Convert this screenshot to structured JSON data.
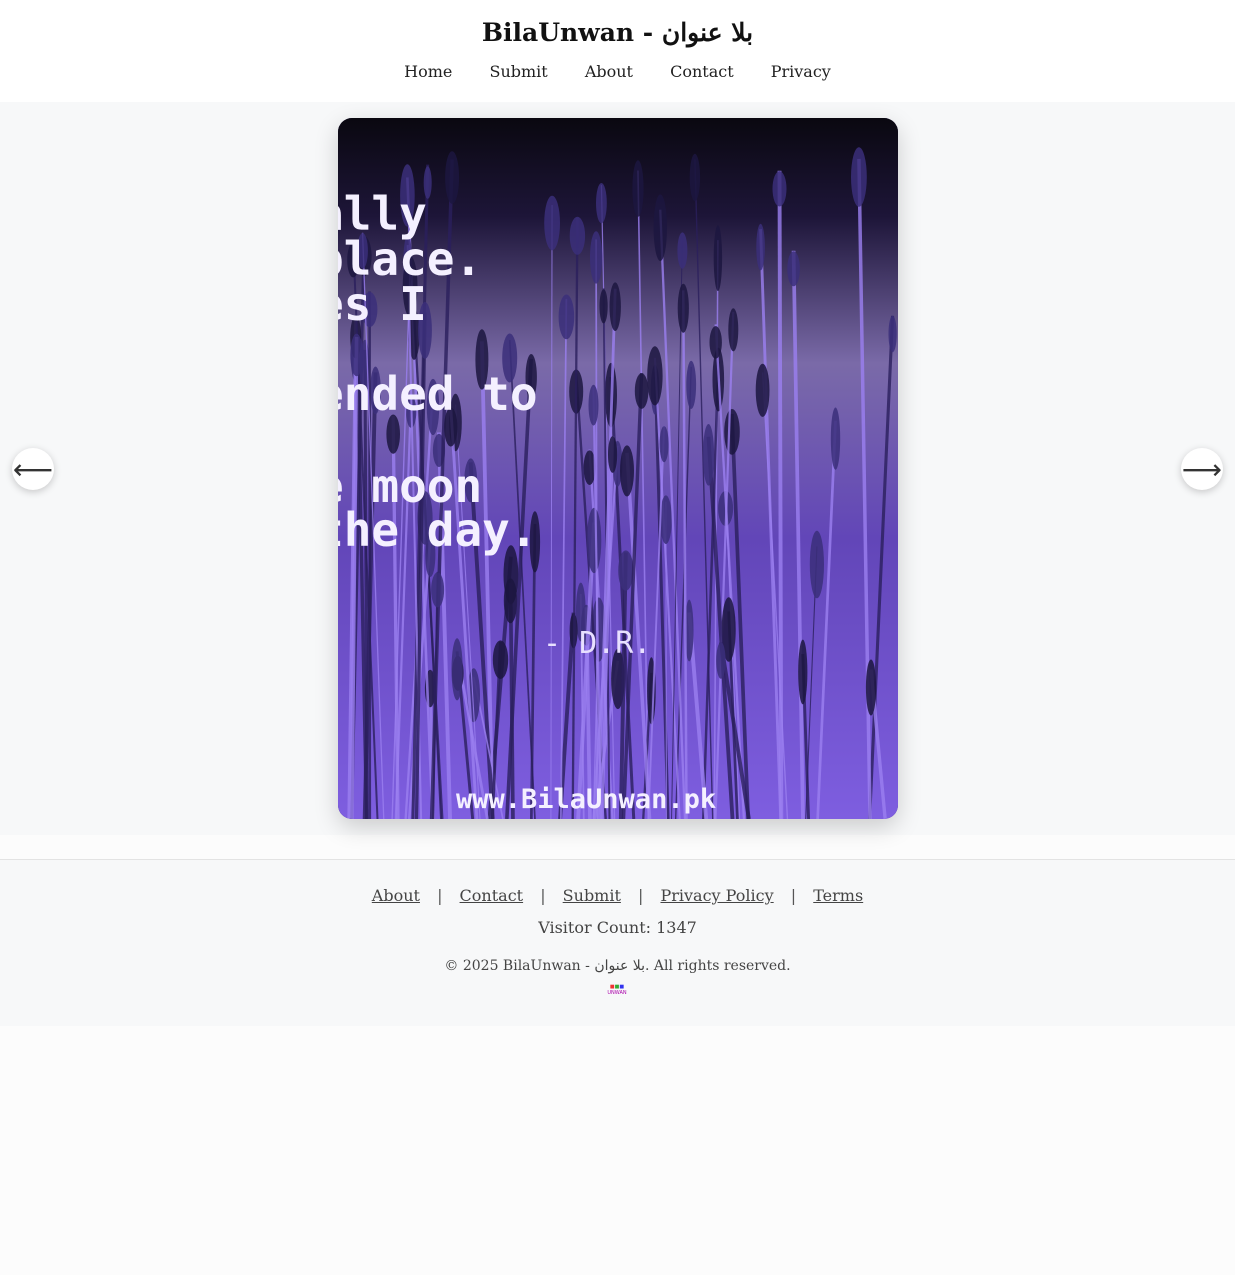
{
  "site": {
    "title": "BilaUnwan - بلا عنوان"
  },
  "nav": {
    "items": [
      "Home",
      "Submit",
      "About",
      "Contact",
      "Privacy"
    ]
  },
  "slider": {
    "prev_icon": "arrow-left-icon",
    "next_icon": "arrow-right-icon",
    "prev_glyph": "⟵",
    "next_glyph": "⟶",
    "slide": {
      "text_lines": [
        "ally",
        "place.",
        "es I",
        "ended to",
        "e moon",
        "the day."
      ],
      "signature": "- D.R.",
      "watermark": "www.BilaUnwan.pk"
    }
  },
  "footer": {
    "links": [
      "About",
      "Contact",
      "Submit",
      "Privacy Policy",
      "Terms"
    ],
    "separator": "|",
    "visitor_count": "Visitor Count: 1347",
    "copyright": "© 2025 BilaUnwan - بلا عنوان. All rights reserved.",
    "logo_text": "UNWAN"
  }
}
